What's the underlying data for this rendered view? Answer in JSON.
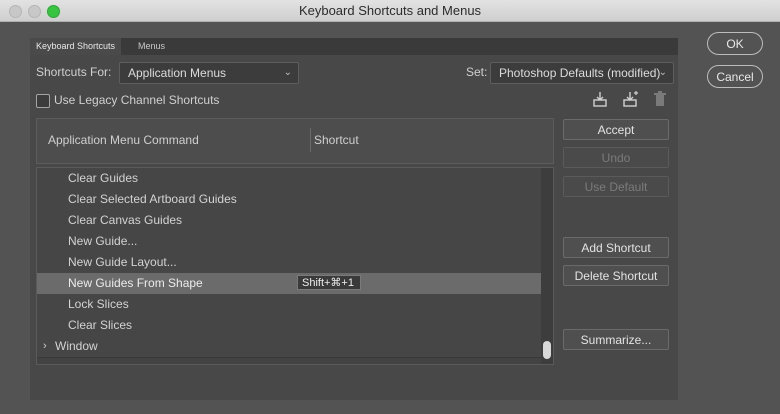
{
  "window": {
    "title": "Keyboard Shortcuts and Menus"
  },
  "tabs": [
    {
      "label": "Keyboard Shortcuts",
      "active": true
    },
    {
      "label": "Menus",
      "active": false
    }
  ],
  "shortcuts_for": {
    "label": "Shortcuts For:",
    "value": "Application Menus"
  },
  "set": {
    "label": "Set:",
    "value": "Photoshop Defaults (modified)"
  },
  "legacy_checkbox": {
    "label": "Use Legacy Channel Shortcuts",
    "checked": false
  },
  "set_icons": [
    "save-set-icon",
    "save-as-new-set-icon",
    "delete-set-icon"
  ],
  "table": {
    "col_command": "Application Menu Command",
    "col_shortcut": "Shortcut",
    "rows": [
      {
        "name": "Clear Guides",
        "shortcut": ""
      },
      {
        "name": "Clear Selected Artboard Guides",
        "shortcut": ""
      },
      {
        "name": "Clear Canvas Guides",
        "shortcut": ""
      },
      {
        "name": "New Guide...",
        "shortcut": ""
      },
      {
        "name": "New Guide Layout...",
        "shortcut": ""
      },
      {
        "name": "New Guides From Shape",
        "shortcut": "Shift+⌘+1",
        "selected": true
      },
      {
        "name": "Lock Slices",
        "shortcut": ""
      },
      {
        "name": "Clear Slices",
        "shortcut": ""
      },
      {
        "name": "Window",
        "shortcut": "",
        "group": true
      }
    ]
  },
  "side_buttons": {
    "accept": "Accept",
    "undo": "Undo",
    "use_default": "Use Default",
    "add_shortcut": "Add Shortcut",
    "delete_shortcut": "Delete Shortcut",
    "summarize": "Summarize..."
  },
  "dialog_buttons": {
    "ok": "OK",
    "cancel": "Cancel"
  }
}
